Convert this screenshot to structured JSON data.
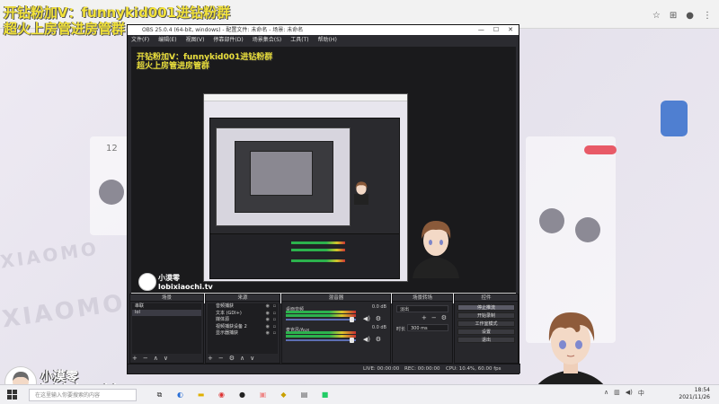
{
  "overlay": {
    "line1": "开钻粉加V：funnykid001进钻粉群",
    "line2": "超火上房管进房管群"
  },
  "obs": {
    "title": "OBS 25.0.4 (64-bit, windows) - 配置文件: 未命名 - 场景: 未命名",
    "menu": [
      "文件(F)",
      "编辑(E)",
      "视图(V)",
      "停靠部件(D)",
      "场景集合(S)",
      "工具(T)",
      "帮助(H)"
    ],
    "docks": {
      "scenes": {
        "title": "场景",
        "items": [
          "串联",
          "lol"
        ]
      },
      "sources": {
        "title": "来源",
        "items": [
          "音频捕获",
          "文本 (GDI+)",
          "媒体源",
          "视频捕获设备 2",
          "显示器捕获"
        ]
      },
      "mixer": {
        "title": "混音器",
        "channels": [
          {
            "name": "桌面音频",
            "db": "0.0 dB"
          },
          {
            "name": "麦克风/Aux",
            "db": "0.0 dB"
          }
        ]
      },
      "transitions": {
        "title": "场景转场",
        "type": "淡出",
        "duration_label": "时长",
        "duration_value": "300 ms"
      },
      "controls": {
        "title": "控件",
        "buttons": [
          "停止推流",
          "开始录制",
          "工作室模式",
          "设置",
          "退出"
        ]
      }
    },
    "status": {
      "live": "LIVE: 00:00:00",
      "rec": "REC: 00:00:00",
      "cpu": "CPU: 10.4%, 60.00 fps"
    }
  },
  "brand": {
    "name": "小漠零",
    "site": "lobixiaochi.tv"
  },
  "taskbar": {
    "search_placeholder": "在这里输入你要搜索的内容",
    "time": "18:54",
    "date": "2021/11/26"
  },
  "bg": {
    "logo_text": "XIAOMO",
    "counter": "12"
  }
}
